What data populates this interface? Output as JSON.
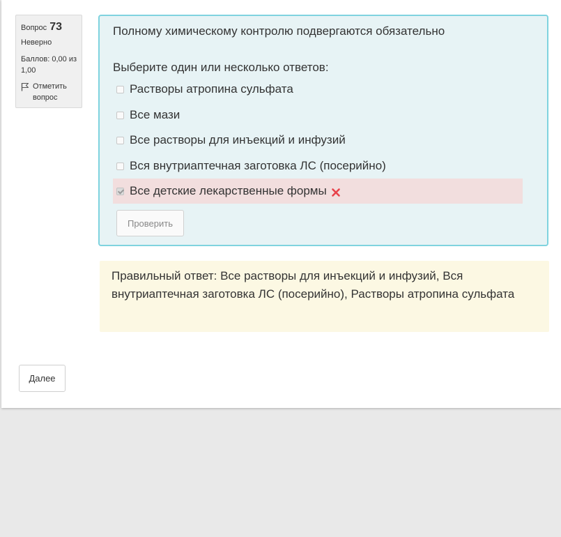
{
  "question_info": {
    "label": "Вопрос",
    "number": "73",
    "state": "Неверно",
    "grade": "Баллов: 0,00 из 1,00",
    "flag_label": "Отметить вопрос",
    "flag_icon": "flag-icon"
  },
  "question": {
    "text": "Полному химическому контролю подвергаются обязательно",
    "prompt": "Выберите один или несколько ответов:",
    "answers": [
      {
        "label": "Растворы атропина сульфата",
        "checked": false
      },
      {
        "label": "Все мази",
        "checked": false
      },
      {
        "label": "Все растворы для инъекций и инфузий",
        "checked": false
      },
      {
        "label": "Вся внутриаптечная заготовка ЛС (посерийно)",
        "checked": false
      },
      {
        "label": "Все детские лекарственные формы",
        "checked": true,
        "status": "incorrect",
        "status_icon": "cross-icon"
      }
    ],
    "check_button": "Проверить"
  },
  "feedback": {
    "right_answer": "Правильный ответ: Все растворы для инъекций и инфузий, Вся внутриаптечная заготовка ЛС (посерийно), Растворы атропина сульфата"
  },
  "navigation": {
    "next_button": "Далее"
  },
  "colors": {
    "formulation_bg": "#e7f3f5",
    "formulation_border": "#7fd3df",
    "incorrect_bg": "#f2dede",
    "feedback_bg": "#fcf8e3",
    "cross_icon": "#e8414a"
  }
}
